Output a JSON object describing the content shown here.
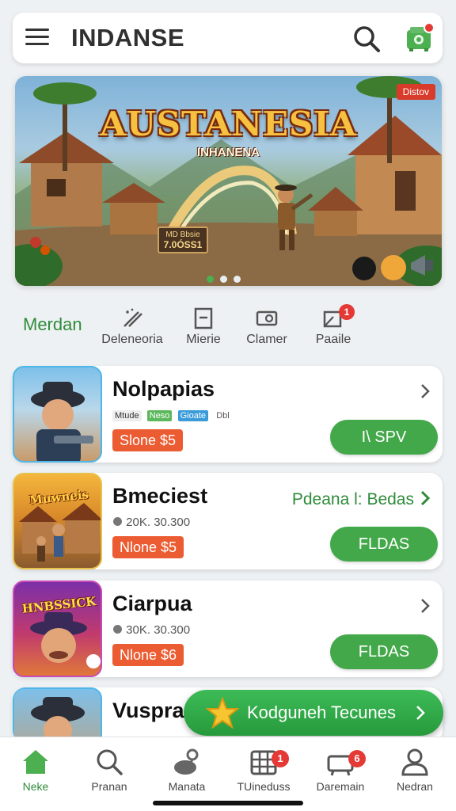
{
  "header": {
    "title": "INDANSE",
    "menu_icon": "menu-icon",
    "search_icon": "search-icon",
    "cart_icon": "cart-icon"
  },
  "banner": {
    "title": "AUSTANESIA",
    "subtitle": "INHANENA",
    "tag": "Distov",
    "sign_label": "MD Bbsie",
    "sign_value": "7.0ÓSS1",
    "page_count": 3,
    "active_page": 1
  },
  "categories": {
    "active": "Merdan",
    "items": [
      {
        "label": "Deleneoria",
        "icon": "wand-icon"
      },
      {
        "label": "Mierie",
        "icon": "document-icon"
      },
      {
        "label": "Clamer",
        "icon": "ticket-icon"
      },
      {
        "label": "Paaile",
        "icon": "flag-icon",
        "badge": "1"
      }
    ]
  },
  "games": [
    {
      "title": "Nolpapias",
      "meta_chips": [
        "Mtude",
        "Neso",
        "Gioate",
        "Dbl"
      ],
      "price": "Slone $5",
      "action": "I\\ SPV"
    },
    {
      "title": "Bmeciest",
      "meta": "20K. 30.300",
      "promo": "Pdeana l: Bedas",
      "price": "Nlone $5",
      "action": "FLDAS",
      "thumb_title": "Muwneis"
    },
    {
      "title": "Ciarpua",
      "meta": "30K. 30.300",
      "price": "Nlone $6",
      "action": "FLDAS",
      "thumb_title": "HNBSSICK"
    },
    {
      "title": "Vusprar"
    }
  ],
  "floating_promo": {
    "label": "Kodguneh Tecunes",
    "icon": "star-icon"
  },
  "bottom_nav": [
    {
      "label": "Neke",
      "icon": "home-icon",
      "active": true
    },
    {
      "label": "Pranan",
      "icon": "search-icon"
    },
    {
      "label": "Manata",
      "icon": "map-pin-icon"
    },
    {
      "label": "TUineduss",
      "icon": "grid-icon",
      "badge": "1"
    },
    {
      "label": "Daremain",
      "icon": "basket-icon",
      "badge": "6"
    },
    {
      "label": "Nedran",
      "icon": "user-icon"
    }
  ],
  "colors": {
    "accent_green": "#43a849",
    "price_orange": "#ec5c32",
    "badge_red": "#e53935",
    "background": "#eef1f3"
  }
}
